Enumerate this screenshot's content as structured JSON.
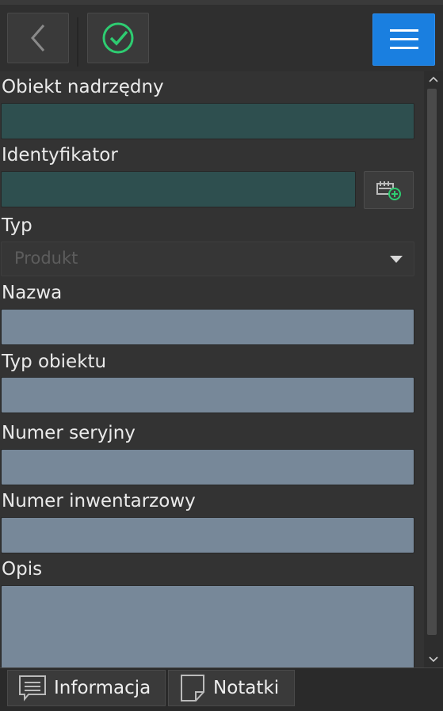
{
  "toolbar": {
    "back_icon": "chevron-left-icon",
    "save_icon": "check-circle-icon",
    "menu_icon": "hamburger-menu-icon",
    "accent_color": "#1a7fe0",
    "check_color": "#2ecc71"
  },
  "form": {
    "parent_object": {
      "label": "Obiekt nadrzędny",
      "value": ""
    },
    "identifier": {
      "label": "Identyfikator",
      "value": "",
      "action_icon": "add-barcode-icon"
    },
    "type": {
      "label": "Typ",
      "value": "Produkt"
    },
    "name": {
      "label": "Nazwa",
      "value": ""
    },
    "object_type": {
      "label": "Typ obiektu",
      "value": ""
    },
    "serial_number": {
      "label": "Numer seryjny",
      "value": ""
    },
    "inventory_number": {
      "label": "Numer inwentarzowy",
      "value": ""
    },
    "description": {
      "label": "Opis",
      "value": ""
    }
  },
  "tabs": [
    {
      "label": "Informacja",
      "icon": "message-icon"
    },
    {
      "label": "Notatki",
      "icon": "note-icon"
    }
  ]
}
